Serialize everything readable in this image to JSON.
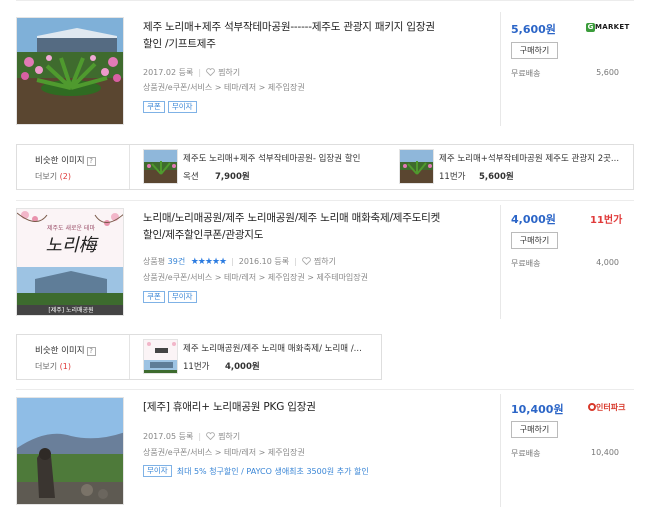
{
  "products": [
    {
      "title_line1": "제주 노리매+제주 석부작테마공원------제주도 관광지 패키지 입장권",
      "title_line2": "할인 /기프트제주",
      "date": "2017.02 등록",
      "wish": "찜하기",
      "category": "상품권/e쿠폰/서비스 > 테마/레저 > 제주입장권",
      "tags": [
        "쿠폰",
        "무이자"
      ],
      "price": "5,600원",
      "buy_label": "구매하기",
      "ship_label": "무료배송",
      "ship_value": "5,600",
      "mall": "G MARKET"
    },
    {
      "title_line1": "노리매/노리매공원/제주 노리매공원/제주 노리매 매화축제/제주도티켓",
      "title_line2": "할인/제주할인쿠폰/관광지도",
      "review_label": "상품평",
      "review_count": "39건",
      "rating": 5,
      "date": "2016.10 등록",
      "wish": "찜하기",
      "category": "상품권/e쿠폰/서비스 > 테마/레저 > 제주입장권 > 제주테마입장권",
      "tags": [
        "쿠폰",
        "무이자"
      ],
      "price": "4,000원",
      "buy_label": "구매하기",
      "ship_label": "무료배송",
      "ship_value": "4,000",
      "mall": "11번가",
      "thumb_caption": "[제주] 노리매공원",
      "thumb_script_top": "제주도 새로운 테마",
      "thumb_script_big": "노리梅"
    },
    {
      "title_line1": "[제주] 휴애리+ 노리매공원 PKG 입장권",
      "date": "2017.05 등록",
      "wish": "찜하기",
      "category": "상품권/e쿠폰/서비스 > 테마/레저 > 제주입장권",
      "tags": [
        "무이자"
      ],
      "promo": "최대 5% 청구할인 / PAYCO 생애최초 3500원 추가 할인",
      "price": "10,400원",
      "buy_label": "구매하기",
      "ship_label": "무료배송",
      "ship_value": "10,400",
      "mall": "인터파크"
    }
  ],
  "similar": [
    {
      "label": "비슷한 이미지",
      "more": "더보기",
      "count": "(2)",
      "items": [
        {
          "title": "제주도 노리매+제주 석부작테마공원- 입장권 할인",
          "mall": "옥션",
          "price": "7,900원"
        },
        {
          "title": "제주 노리매+석부작테마공원 제주도 관광지 2곳...",
          "mall": "11번가",
          "price": "5,600원"
        }
      ]
    },
    {
      "label": "비슷한 이미지",
      "more": "더보기",
      "count": "(1)",
      "items": [
        {
          "title": "제주 노리매공원/제주 노리매 매화축제/ 노리매 /...",
          "mall": "11번가",
          "price": "4,000원"
        }
      ]
    }
  ],
  "colors": {
    "accent": "#2b65c7",
    "tag": "#3a86d6",
    "star": "#2b7be0",
    "red": "#e03a3a"
  }
}
